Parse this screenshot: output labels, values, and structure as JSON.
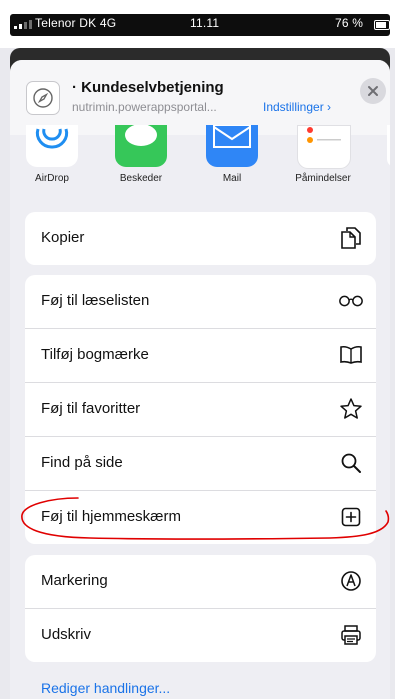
{
  "status": {
    "carrier": "Telenor DK 4G",
    "time": "11.11",
    "battery": "76 %"
  },
  "header": {
    "title": "· Kundeselvbetjening",
    "url": "nutrimin.powerappsportal...",
    "options_label": "Indstillinger ›",
    "close_icon": "close-icon"
  },
  "apps": [
    {
      "label": "AirDrop",
      "icon": "airdrop-icon",
      "color": "#1f8ef1"
    },
    {
      "label": "Beskeder",
      "icon": "messages-icon",
      "color": "#36c759"
    },
    {
      "label": "Mail",
      "icon": "mail-icon",
      "color": "#2f86f6"
    },
    {
      "label": "Påmindelser",
      "icon": "reminders-icon",
      "color": "#ffffff"
    }
  ],
  "actions": {
    "copy": "Kopier",
    "reading_list": "Føj til læselisten",
    "bookmark": "Tilføj bogmærke",
    "favorites": "Føj til favoritter",
    "find": "Find på side",
    "home_screen": "Føj til hjemmeskærm",
    "markup": "Markering",
    "print": "Udskriv"
  },
  "edit_actions": "Rediger handlinger...",
  "colors": {
    "accent": "#1a73e8",
    "annotation": "#e00000"
  }
}
